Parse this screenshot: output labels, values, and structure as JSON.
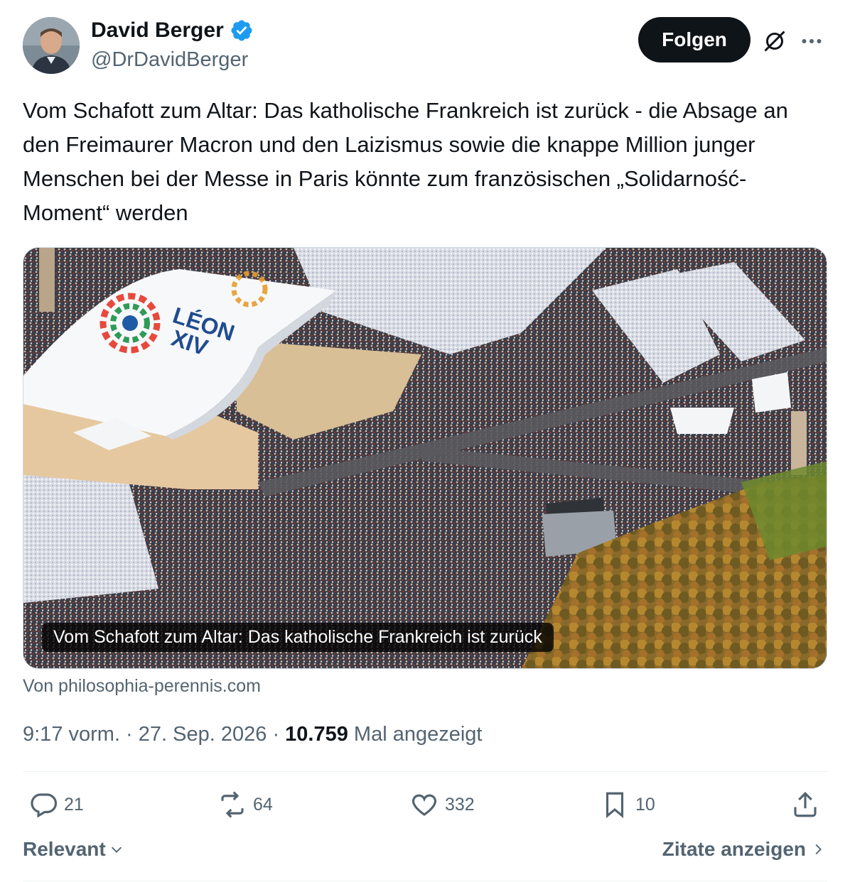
{
  "author": {
    "display_name": "David Berger",
    "handle": "@DrDavidBerger"
  },
  "follow_label": "Folgen",
  "tweet": {
    "text": "Vom Schafott zum Altar: Das katholische Frankreich ist zurück - die Absage an den Freimaurer Macron und den Laizismus sowie die knappe Million junger Menschen bei der Messe in Paris könnte zum französischen „Solidarność-Moment“ werden"
  },
  "media": {
    "caption": "Vom Schafott zum Altar: Das katholische Frankreich ist zurück",
    "tent_logo_text_1": "LÉON",
    "tent_logo_text_2": "XIV"
  },
  "source": "Von philosophia-perennis.com",
  "meta": {
    "time": "9:17 vorm.",
    "sep1": " · ",
    "date": "27. Sep. 2026",
    "sep2": " · ",
    "views": "10.759",
    "views_label": " Mal angezeigt"
  },
  "actions": {
    "replies": "21",
    "reposts": "64",
    "likes": "332",
    "bookmarks": "10"
  },
  "footer": {
    "relevant": "Relevant",
    "quotes": "Zitate anzeigen"
  },
  "colors": {
    "verified": "#1d9bf0",
    "text_primary": "#0f1419",
    "text_secondary": "#536471",
    "follow_bg": "#0f1419"
  },
  "icons": [
    "verified-badge-icon",
    "grok-icon",
    "more-icon",
    "reply-icon",
    "repost-icon",
    "like-icon",
    "bookmark-icon",
    "share-icon",
    "chevron-down-icon",
    "chevron-right-icon"
  ]
}
